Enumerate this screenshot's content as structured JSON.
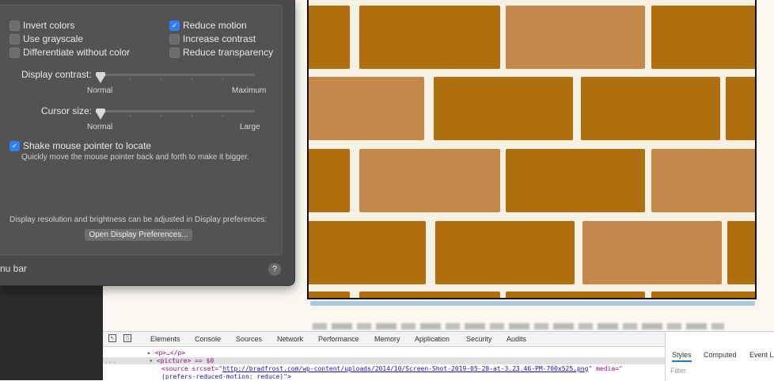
{
  "accessibility": {
    "checkboxes_left": [
      {
        "label": "Invert colors",
        "checked": false
      },
      {
        "label": "Use grayscale",
        "checked": false
      },
      {
        "label": "Differentiate without color",
        "checked": false
      }
    ],
    "checkboxes_right": [
      {
        "label": "Reduce motion",
        "checked": true
      },
      {
        "label": "Increase contrast",
        "checked": false
      },
      {
        "label": "Reduce transparency",
        "checked": false
      }
    ],
    "display_contrast": {
      "label": "Display contrast:",
      "min_label": "Normal",
      "max_label": "Maximum",
      "value": 0
    },
    "cursor_size": {
      "label": "Cursor size:",
      "min_label": "Normal",
      "max_label": "Large",
      "value": 0
    },
    "shake": {
      "label": "Shake mouse pointer to locate",
      "checked": true,
      "description": "Quickly move the mouse pointer back and forth to make it bigger."
    },
    "display_note": "Display resolution and brightness can be adjusted in Display preferences:",
    "open_display_button": "Open Display Preferences...",
    "menu_bar_label": "nu bar",
    "help_label": "?"
  },
  "devtools": {
    "tabs": [
      "Elements",
      "Console",
      "Sources",
      "Network",
      "Performance",
      "Memory",
      "Application",
      "Security",
      "Audits"
    ],
    "dom": {
      "line1": "<p>…</p>",
      "line2": "<picture> == $0",
      "line3_prefix": "<source srcset=\"",
      "line3_url": "http://bradfrost.com/wp-content/uploads/2014/10/Screen-Shot-2019-05-28-at-3.23.46-PM-700x525.png",
      "line3_suffix": "\" media=\"",
      "line4": "(prefers-reduced-motion: reduce)\">",
      "ellipsis": "..."
    },
    "side_tabs": [
      "Styles",
      "Computed",
      "Event L"
    ],
    "filter_placeholder": "Filter"
  },
  "colors": {
    "brick_dark": "#b06f0e",
    "brick_light": "#c4894a",
    "mortar": "#f7f1e4",
    "checkbox_on": "#2f7ef6"
  }
}
